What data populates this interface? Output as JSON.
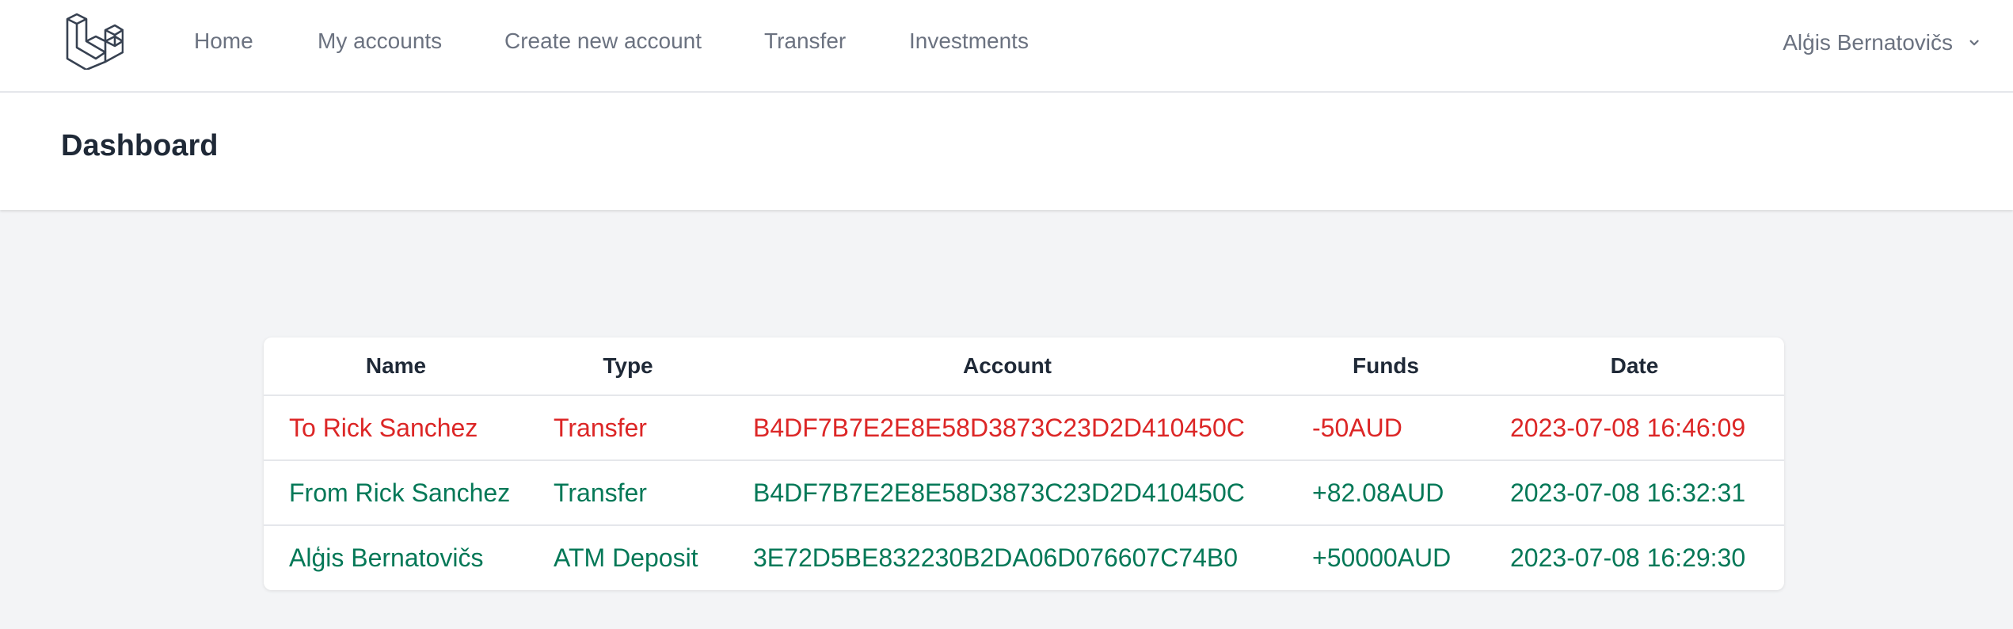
{
  "nav": {
    "logo_icon": "laravel-logo-icon",
    "links": [
      {
        "label": "Home"
      },
      {
        "label": "My accounts"
      },
      {
        "label": "Create new account"
      },
      {
        "label": "Transfer"
      },
      {
        "label": "Investments"
      }
    ],
    "user": {
      "name": "Alģis Bernatovičs",
      "icon": "chevron-down-icon"
    }
  },
  "header": {
    "title": "Dashboard"
  },
  "transactions": {
    "columns": [
      "Name",
      "Type",
      "Account",
      "Funds",
      "Date"
    ],
    "rows": [
      {
        "name": "To Rick Sanchez",
        "type": "Transfer",
        "account": "B4DF7B7E2E8E58D3873C23D2D410450C",
        "funds": "-50AUD",
        "date": "2023-07-08 16:46:09",
        "direction": "outgoing"
      },
      {
        "name": "From Rick Sanchez",
        "type": "Transfer",
        "account": "B4DF7B7E2E8E58D3873C23D2D410450C",
        "funds": "+82.08AUD",
        "date": "2023-07-08 16:32:31",
        "direction": "incoming"
      },
      {
        "name": "Alģis Bernatovičs",
        "type": "ATM Deposit",
        "account": "3E72D5BE832230B2DA06D076607C74B0",
        "funds": "+50000AUD",
        "date": "2023-07-08 16:29:30",
        "direction": "incoming"
      }
    ]
  },
  "colors": {
    "outgoing": "#dc2626",
    "incoming": "#047857"
  }
}
